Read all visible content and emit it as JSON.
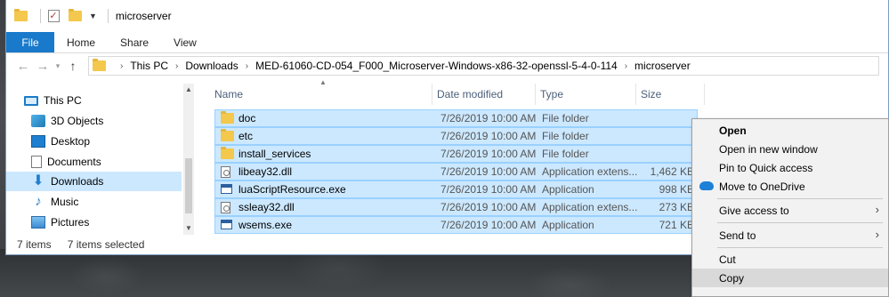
{
  "window": {
    "title": "microserver"
  },
  "ribbon": {
    "tabs": [
      "File",
      "Home",
      "Share",
      "View"
    ]
  },
  "address": {
    "crumbs": [
      "This PC",
      "Downloads",
      "MED-61060-CD-054_F000_Microserver-Windows-x86-32-openssl-5-4-0-114",
      "microserver"
    ]
  },
  "nav": {
    "items": [
      {
        "label": "This PC",
        "icon": "computer-icon"
      },
      {
        "label": "3D Objects",
        "icon": "3d-objects-icon"
      },
      {
        "label": "Desktop",
        "icon": "desktop-icon"
      },
      {
        "label": "Documents",
        "icon": "documents-icon"
      },
      {
        "label": "Downloads",
        "icon": "downloads-icon",
        "selected": true
      },
      {
        "label": "Music",
        "icon": "music-icon"
      },
      {
        "label": "Pictures",
        "icon": "pictures-icon"
      }
    ]
  },
  "columns": {
    "name": "Name",
    "date": "Date modified",
    "type": "Type",
    "size": "Size"
  },
  "files": [
    {
      "name": "doc",
      "date": "7/26/2019 10:00 AM",
      "type": "File folder",
      "size": "",
      "icon": "folder-icon"
    },
    {
      "name": "etc",
      "date": "7/26/2019 10:00 AM",
      "type": "File folder",
      "size": "",
      "icon": "folder-icon"
    },
    {
      "name": "install_services",
      "date": "7/26/2019 10:00 AM",
      "type": "File folder",
      "size": "",
      "icon": "folder-icon"
    },
    {
      "name": "libeay32.dll",
      "date": "7/26/2019 10:00 AM",
      "type": "Application extens...",
      "size": "1,462 KB",
      "icon": "dll-file-icon"
    },
    {
      "name": "luaScriptResource.exe",
      "date": "7/26/2019 10:00 AM",
      "type": "Application",
      "size": "998 KB",
      "icon": "exe-file-icon"
    },
    {
      "name": "ssleay32.dll",
      "date": "7/26/2019 10:00 AM",
      "type": "Application extens...",
      "size": "273 KB",
      "icon": "dll-file-icon"
    },
    {
      "name": "wsems.exe",
      "date": "7/26/2019 10:00 AM",
      "type": "Application",
      "size": "721 KB",
      "icon": "exe-file-icon"
    }
  ],
  "status": {
    "count": "7 items",
    "selected": "7 items selected"
  },
  "context_menu": {
    "items": [
      {
        "label": "Open",
        "bold": true
      },
      {
        "label": "Open in new window"
      },
      {
        "label": "Pin to Quick access"
      },
      {
        "label": "Move to OneDrive",
        "icon": "onedrive-icon"
      },
      {
        "label": "Give access to",
        "submenu": true
      },
      {
        "label": "Send to",
        "submenu": true
      },
      {
        "label": "Cut"
      },
      {
        "label": "Copy",
        "highlighted": true
      }
    ]
  },
  "colors": {
    "file_tab": "#1979ca",
    "selection": "#cce8ff",
    "selection_border": "#99d1ff",
    "folder": "#f3c84c"
  }
}
